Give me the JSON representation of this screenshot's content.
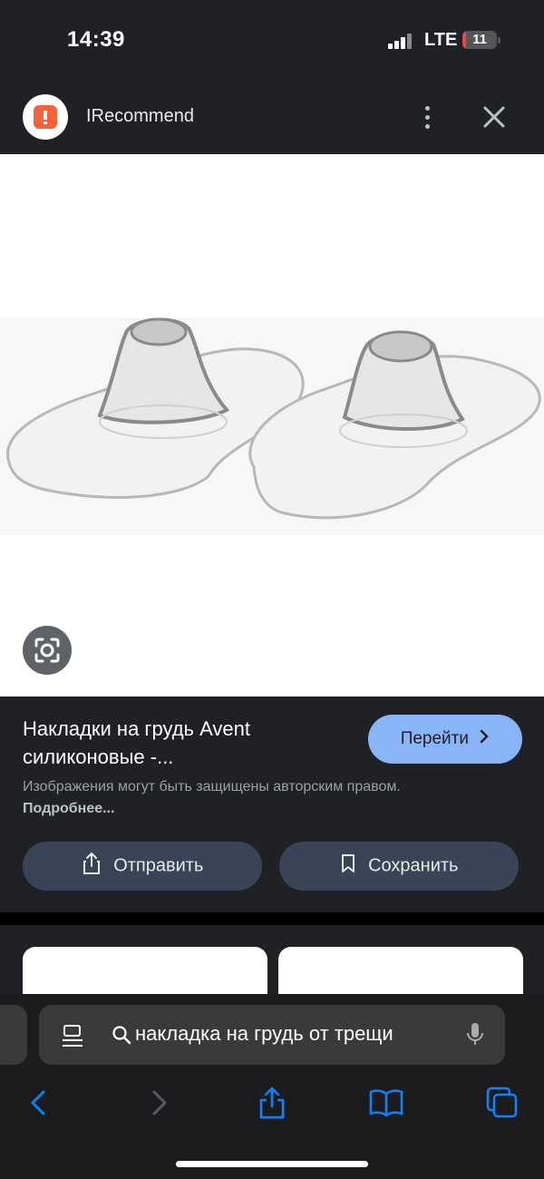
{
  "status_bar": {
    "time": "14:39",
    "network": "LTE",
    "battery": "11",
    "battery_level": 0.11,
    "battery_color": "#e5484d"
  },
  "header": {
    "site_name": "IRecommend",
    "logo_color": "#f4623a"
  },
  "result": {
    "title": "Накладки на грудь Avent силиконовые -...",
    "go_label": "Перейти",
    "copyright_text": "Изображения могут быть защищены авторским правом.",
    "more_link": "Подробнее...",
    "share_label": "Отправить",
    "save_label": "Сохранить"
  },
  "browser": {
    "address": "накладка на грудь от трещи"
  },
  "colors": {
    "accent": "#8ab4f8",
    "button_bg": "#394457",
    "toolbar_blue": "#0a84ff"
  }
}
